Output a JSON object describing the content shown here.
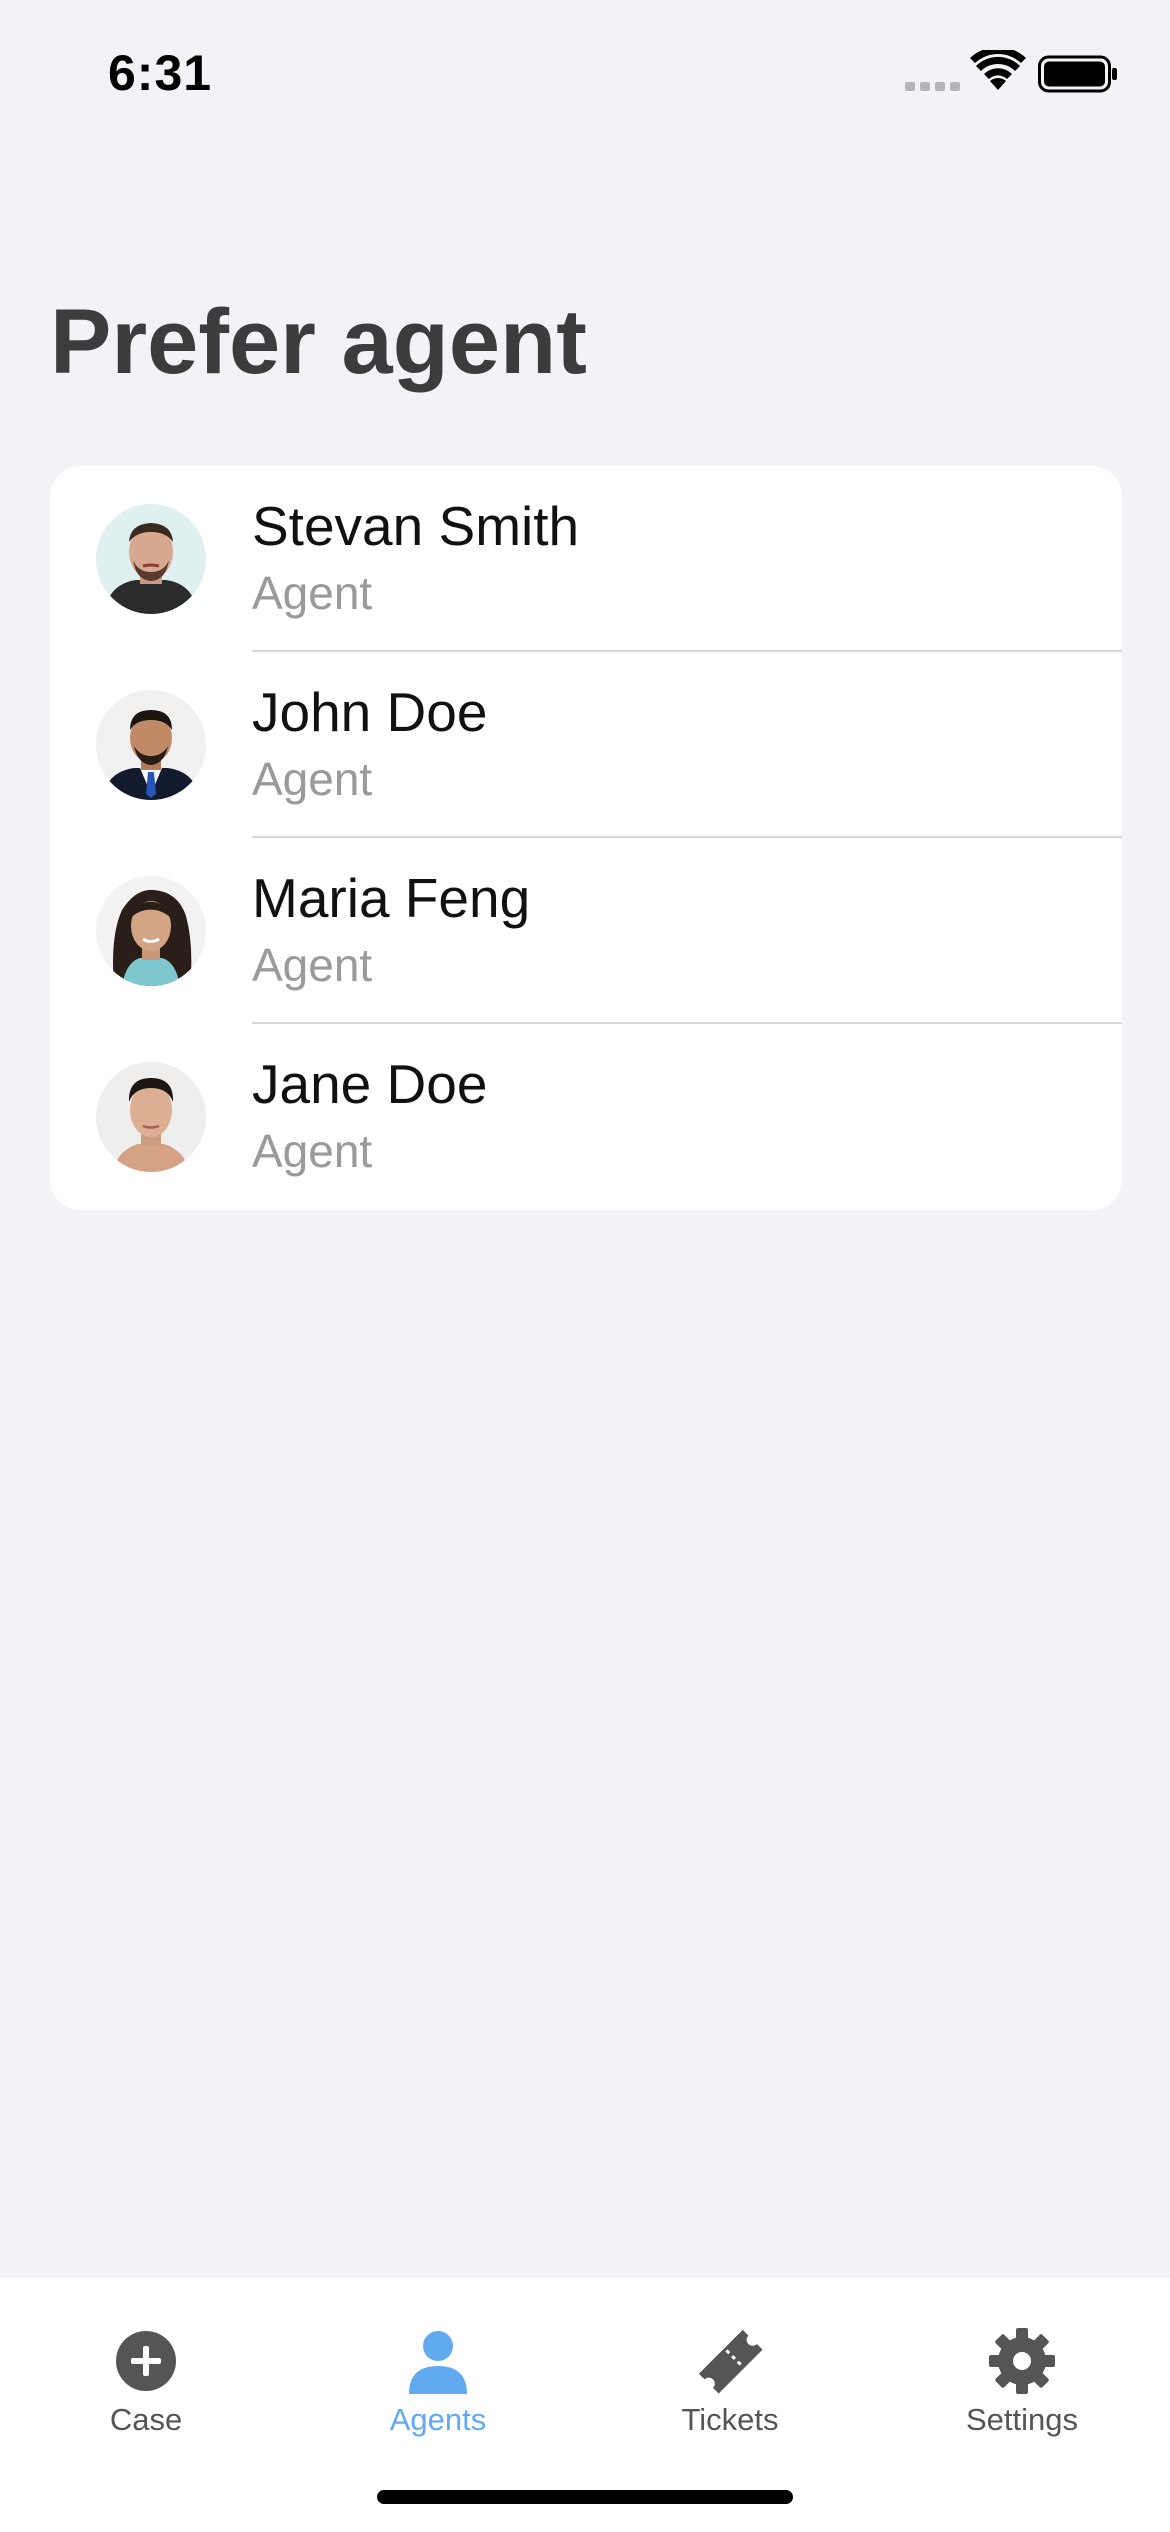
{
  "status_bar": {
    "time": "6:31",
    "icons": [
      "signal-icon",
      "wifi-icon",
      "battery-icon"
    ]
  },
  "page": {
    "title": "Prefer agent"
  },
  "agents": [
    {
      "name": "Stevan Smith",
      "role": "Agent",
      "avatar_icon": "avatar-icon"
    },
    {
      "name": "John Doe",
      "role": "Agent",
      "avatar_icon": "avatar-icon"
    },
    {
      "name": "Maria Feng",
      "role": "Agent",
      "avatar_icon": "avatar-icon"
    },
    {
      "name": "Jane Doe",
      "role": "Agent",
      "avatar_icon": "avatar-icon"
    }
  ],
  "tab_bar": {
    "tabs": [
      {
        "label": "Case",
        "icon": "plus-circle-icon",
        "active": false
      },
      {
        "label": "Agents",
        "icon": "person-icon",
        "active": true
      },
      {
        "label": "Tickets",
        "icon": "ticket-icon",
        "active": false
      },
      {
        "label": "Settings",
        "icon": "gear-icon",
        "active": false
      }
    ]
  },
  "colors": {
    "background": "#f2f2f7",
    "card": "#ffffff",
    "title": "#3c3c3e",
    "secondary_text": "#9a9a9e",
    "active_tab": "#62aaf0",
    "inactive_tab": "#555558"
  }
}
